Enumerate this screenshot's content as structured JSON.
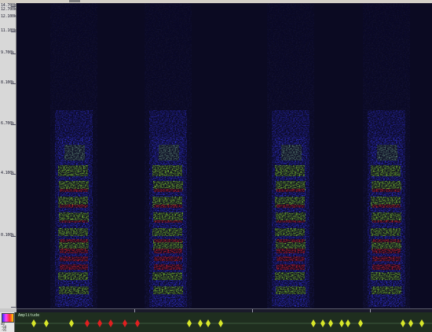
{
  "window": {
    "title": ""
  },
  "frequency_axis": {
    "labels": [
      "14.700k",
      "12.700k",
      "12.100k",
      "11.100k",
      "9.700k",
      "8.100k",
      "6.700k",
      "4.100k",
      "0.100k"
    ]
  },
  "amplitude_panel": {
    "title": "Amplitude",
    "scale_labels": [
      "dB",
      "-60",
      "-95"
    ]
  },
  "colors": {
    "background": "#0b0a22",
    "low": "#2b2bc8",
    "mid": "#8fe02a",
    "high": "#e8202a",
    "amp_track": "#1f2e1f",
    "amp_marks": "#d8e82a",
    "amp_marks_selected": "#e02020"
  },
  "icons": {
    "palette": "color-palette-icon"
  }
}
